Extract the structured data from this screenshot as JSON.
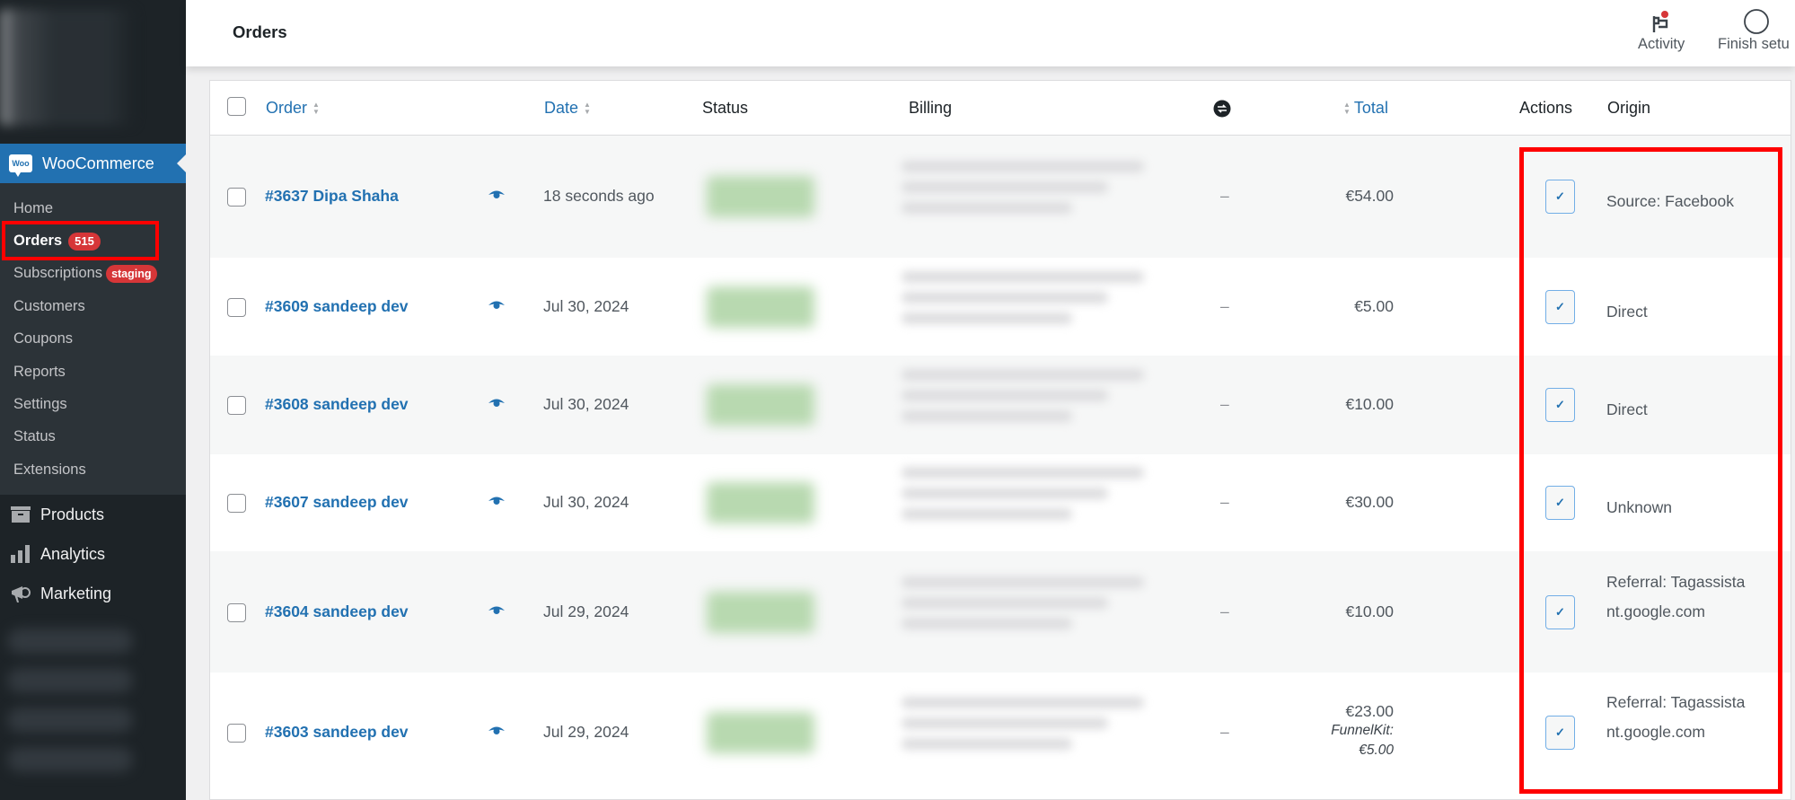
{
  "sidebar": {
    "woocommerce_label": "WooCommerce",
    "woo_logo_text": "Woo",
    "submenu": [
      {
        "label": "Home"
      },
      {
        "label": "Orders",
        "badge": "515",
        "current": true
      },
      {
        "label": "Subscriptions",
        "badge": "staging"
      },
      {
        "label": "Customers"
      },
      {
        "label": "Coupons"
      },
      {
        "label": "Reports"
      },
      {
        "label": "Settings"
      },
      {
        "label": "Status"
      },
      {
        "label": "Extensions"
      }
    ],
    "main_items": [
      {
        "label": "Products",
        "icon": "archive-box-icon"
      },
      {
        "label": "Analytics",
        "icon": "bar-chart-icon"
      },
      {
        "label": "Marketing",
        "icon": "megaphone-icon"
      }
    ]
  },
  "header": {
    "title": "Orders",
    "activity_label": "Activity",
    "finish_setup_label": "Finish setu"
  },
  "table": {
    "columns": {
      "order": "Order",
      "date": "Date",
      "status": "Status",
      "billing": "Billing",
      "total": "Total",
      "actions": "Actions",
      "origin": "Origin"
    },
    "rows": [
      {
        "order": "#3637 Dipa Shaha",
        "date": "18 seconds ago",
        "attribution": "–",
        "total": "€54.00",
        "total_meta": "",
        "total_meta_value": "",
        "action_icon": "✓",
        "origin": "Source: Facebook"
      },
      {
        "order": "#3609 sandeep dev",
        "date": "Jul 30, 2024",
        "attribution": "–",
        "total": "€5.00",
        "total_meta": "",
        "total_meta_value": "",
        "action_icon": "✓",
        "origin": "Direct"
      },
      {
        "order": "#3608 sandeep dev",
        "date": "Jul 30, 2024",
        "attribution": "–",
        "total": "€10.00",
        "total_meta": "",
        "total_meta_value": "",
        "action_icon": "✓",
        "origin": "Direct"
      },
      {
        "order": "#3607 sandeep dev",
        "date": "Jul 30, 2024",
        "attribution": "–",
        "total": "€30.00",
        "total_meta": "",
        "total_meta_value": "",
        "action_icon": "✓",
        "origin": "Unknown"
      },
      {
        "order": "#3604 sandeep dev",
        "date": "Jul 29, 2024",
        "attribution": "–",
        "total": "€10.00",
        "total_meta": "",
        "total_meta_value": "",
        "action_icon": "✓",
        "origin": "Referral: Tagassistant.google.com"
      },
      {
        "order": "#3603 sandeep dev",
        "date": "Jul 29, 2024",
        "attribution": "–",
        "total": "€23.00",
        "total_meta": "FunnelKit:",
        "total_meta_value": "€5.00",
        "action_icon": "✓",
        "origin": "Referral: Tagassistant.google.com"
      }
    ]
  },
  "colors": {
    "accent": "#2271b1",
    "sidebar_bg": "#1d2327",
    "submenu_bg": "#2c3338",
    "badge": "#d63638",
    "highlight": "#ff0000"
  }
}
